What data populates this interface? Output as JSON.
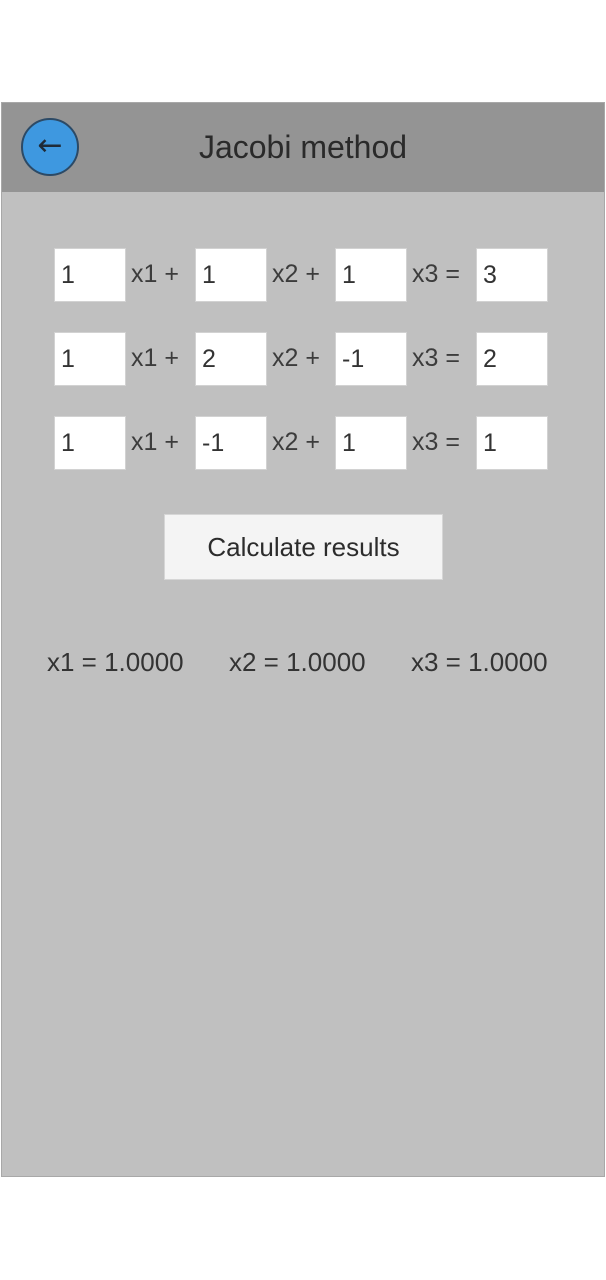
{
  "header": {
    "back_icon": "←",
    "title": "Jacobi method"
  },
  "equations": [
    {
      "coefficients": [
        "1",
        "1",
        "1"
      ],
      "rhs": "3",
      "labels": [
        "x1 +",
        "x2 +",
        "x3 ="
      ]
    },
    {
      "coefficients": [
        "1",
        "2",
        "-1"
      ],
      "rhs": "2",
      "labels": [
        "x1 +",
        "x2 +",
        "x3 ="
      ]
    },
    {
      "coefficients": [
        "1",
        "-1",
        "1"
      ],
      "rhs": "1",
      "labels": [
        "x1 +",
        "x2 +",
        "x3 ="
      ]
    }
  ],
  "calculate_label": "Calculate results",
  "results": {
    "x1": "x1 = 1.0000",
    "x2": "x2 = 1.0000",
    "x3": "x3 = 1.0000"
  },
  "colors": {
    "accent": "#3e98e0",
    "header_bg": "#949494",
    "body_bg": "#c0c0c0"
  }
}
